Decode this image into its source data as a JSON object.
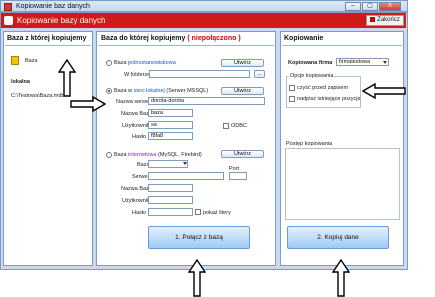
{
  "window": {
    "title": "Kopiowanie baz danych",
    "min": "–",
    "max": "▢",
    "close": "X"
  },
  "header": {
    "title": "Kopiowanie bazy danych",
    "exit_label": "Zakończ"
  },
  "left": {
    "title": "Baza z której kopiujemy",
    "db_label": "Baza",
    "type_label": "lokalna",
    "path": "C:\\Testowa\\Baza.mdb"
  },
  "middle": {
    "title": "Baza do której kopiujemy",
    "status": "( niepołączono )",
    "opt1": {
      "prefix": "Baza ",
      "highlight": "jednostanowiskowa",
      "file_label": "W folderze",
      "change_label": "Utwórz",
      "browse_label": "..."
    },
    "opt2": {
      "prefix": "Baza w ",
      "highlight": "sieci lokalnej",
      "suffix": " (Serwer MSSQL)",
      "change_label": "Utwórz",
      "server_label": "Nazwa serwera",
      "server_value": "dorota-dorota",
      "dbname_label": "Nazwa Bazy",
      "dbname_value": "baza",
      "user_label": "Użytkownik",
      "user_value": "sa",
      "pass_label": "Hasło",
      "pass_value": "f8fa8",
      "odbc_label": "ODBC"
    },
    "opt3": {
      "prefix": "Baza ",
      "highlight": "internetowa",
      "suffix": " (MySQL, Firebird)",
      "change_label": "Utwórz",
      "db_label": "Baza",
      "port_label": "Port",
      "server_label": "Serwer",
      "dbname_label": "Nazwa Bazy",
      "user_label": "Użytkownik",
      "pass_label": "Hasło",
      "show_pass_label": "pokaż litery"
    },
    "connect_label": "1. Połącz z bazą"
  },
  "right": {
    "title": "Kopiowanie",
    "firm_label": "Kopiowana firma",
    "firm_value": "firmatestowa",
    "options_title": "Opcje kopiowania",
    "opt_clear": "czyść przed zapisem",
    "opt_overwrite": "nadpisz istniejące pozycje",
    "progress_label": "Postęp kopiowania",
    "copy_label": "2. Kopiuj dane"
  }
}
